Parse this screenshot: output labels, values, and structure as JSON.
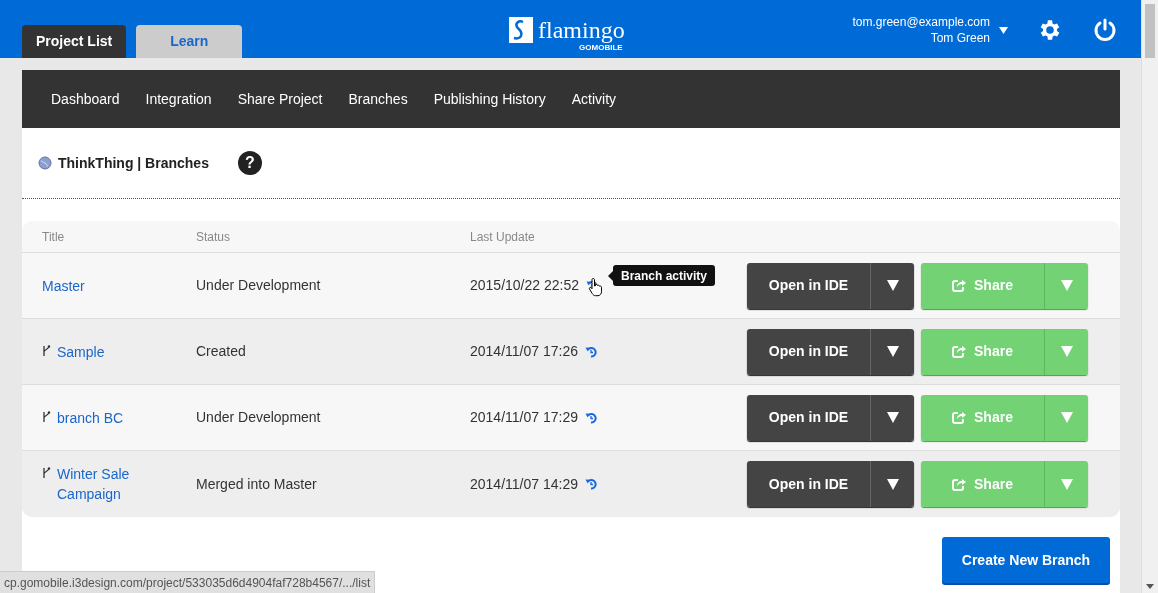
{
  "header": {
    "tabs": [
      {
        "label": "Project List",
        "selected": true
      },
      {
        "label": "Learn",
        "selected": false
      }
    ],
    "logo": {
      "name": "flamingo",
      "sub": "GOMOBILE"
    },
    "user": {
      "email": "tom.green@example.com",
      "name": "Tom Green"
    }
  },
  "nav": [
    "Dashboard",
    "Integration",
    "Share Project",
    "Branches",
    "Publishing History",
    "Activity"
  ],
  "breadcrumb": "ThinkThing | Branches",
  "help": "?",
  "table": {
    "columns": [
      "Title",
      "Status",
      "Last Update"
    ],
    "rows": [
      {
        "title": "Master",
        "branch": false,
        "status": "Under Development",
        "updated": "2015/10/22 22:52",
        "tooltip": "Branch activity",
        "open": "Open in IDE",
        "share": "Share"
      },
      {
        "title": "Sample",
        "branch": true,
        "status": "Created",
        "updated": "2014/11/07 17:26",
        "open": "Open in IDE",
        "share": "Share"
      },
      {
        "title": "branch BC",
        "branch": true,
        "status": "Under Development",
        "updated": "2014/11/07 17:29",
        "open": "Open in IDE",
        "share": "Share"
      },
      {
        "title": "Winter Sale Campaign",
        "branch": true,
        "status": "Merged into Master",
        "updated": "2014/11/07 14:29",
        "open": "Open in IDE",
        "share": "Share"
      }
    ]
  },
  "create_button": "Create New Branch",
  "status_bar": "cp.gomobile.i3design.com/project/533035d6d4904faf728b4567/.../list"
}
